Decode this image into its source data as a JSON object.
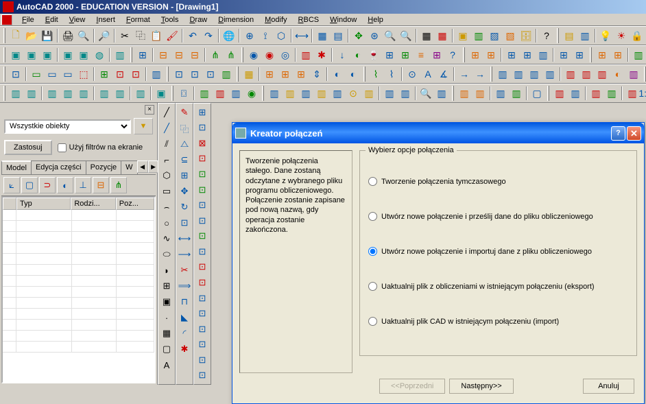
{
  "app": {
    "title": "AutoCAD 2000 - EDUCATION VERSION - [Drawing1]"
  },
  "menu": {
    "file": "File",
    "edit": "Edit",
    "view": "View",
    "insert": "Insert",
    "format": "Format",
    "tools": "Tools",
    "draw": "Draw",
    "dimension": "Dimension",
    "modify": "Modify",
    "rbcs": "RBCS",
    "window": "Window",
    "help": "Help"
  },
  "left_panel": {
    "filter_selected": "Wszystkie obiekty",
    "apply_btn": "Zastosuj",
    "use_filters_checkbox": "Użyj filtrów na ekranie",
    "tabs": {
      "model": "Model",
      "edit_part": "Edycja części",
      "positions": "Pozycje",
      "w": "W"
    },
    "table_headers": {
      "typ": "Typ",
      "rodzi": "Rodzi...",
      "poz": "Poz..."
    }
  },
  "dialog": {
    "title": "Kreator połączeń",
    "description": "Tworzenie połączenia stałego. Dane zostaną odczytane z wybranego pliku programu obliczeniowego. Połączenie zostanie zapisane pod nową nazwą, gdy operacja zostanie zakończona.",
    "options_legend": "Wybierz opcje połączenia",
    "options": {
      "opt1": "Tworzenie połączenia tymczasowego",
      "opt2": "Utwórz nowe połączenie i prześlij dane do pliku obliczeniowego",
      "opt3": "Utwórz nowe połączenie i importuj dane z pliku obliczeniowego",
      "opt4": "Uaktualnij plik z obliczeniami w istniejącym połączeniu (eksport)",
      "opt5": "Uaktualnij plik CAD w istniejącym połączeniu (import)"
    },
    "selected_option": "opt3",
    "buttons": {
      "prev": "<<Poprzedni",
      "next": "Następny>>",
      "cancel": "Anuluj"
    }
  }
}
